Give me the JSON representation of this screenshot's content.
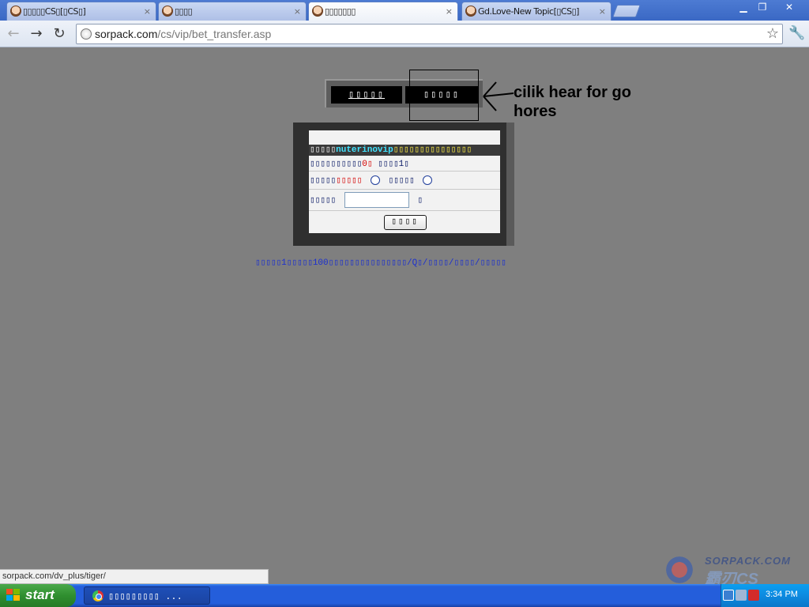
{
  "browser": {
    "tabs": [
      {
        "label": "▯▯▯▯▯CS▯[▯CS▯]",
        "active": false
      },
      {
        "label": "▯▯▯▯",
        "active": false
      },
      {
        "label": "▯▯▯▯▯▯▯",
        "active": true
      },
      {
        "label": "Gd.Love-New Topic[▯CS▯]",
        "active": false
      }
    ],
    "tab_close": "×",
    "back_icon": "←",
    "forward_icon": "→",
    "reload_icon": "↻",
    "url_host": "sorpack.com",
    "url_path": "/cs/vip/bet_transfer.asp",
    "bookmark_icon": "☆",
    "wrench_icon": "🔧",
    "window_controls": {
      "minimize": "▁",
      "restore": "❐",
      "close": "✕"
    }
  },
  "page": {
    "nav_buttons": [
      "▯▯▯▯▯",
      "▯▯▯▯▯"
    ],
    "annotation": "cilik hear for go hores",
    "panel": {
      "header_prefix": "▯▯▯▯▯",
      "header_name": "nuterinovip",
      "header_suffix": "▯▯▯▯▯▯▯▯▯▯▯▯▯▯▯",
      "row1_text": "▯▯▯▯▯▯▯▯▯▯",
      "row1_value": "0▯",
      "row1_extra": "▯▯▯▯1▯",
      "row2_label1": "▯▯▯▯▯",
      "row2_red": "▯▯▯▯▯",
      "row2_label2": "▯▯▯▯▯",
      "row3_label": "▯▯▯▯▯",
      "row3_input_value": "",
      "row3_suffix": "▯",
      "submit_label": "▯▯▯▯"
    },
    "notice": "▯▯▯▯▯1▯▯▯▯▯100▯▯▯▯▯▯▯▯▯▯▯▯▯▯▯/Q▯/▯▯▯▯/▯▯▯▯/▯▯▯▯▯"
  },
  "status_url": "sorpack.com/dv_plus/tiger/",
  "watermark": {
    "top": "SORPACK.COM",
    "bottom": "霸刃CS"
  },
  "taskbar": {
    "start_label": "start",
    "task_label": "▯▯▯▯▯▯▯▯▯ ...",
    "clock": "3:34 PM"
  }
}
